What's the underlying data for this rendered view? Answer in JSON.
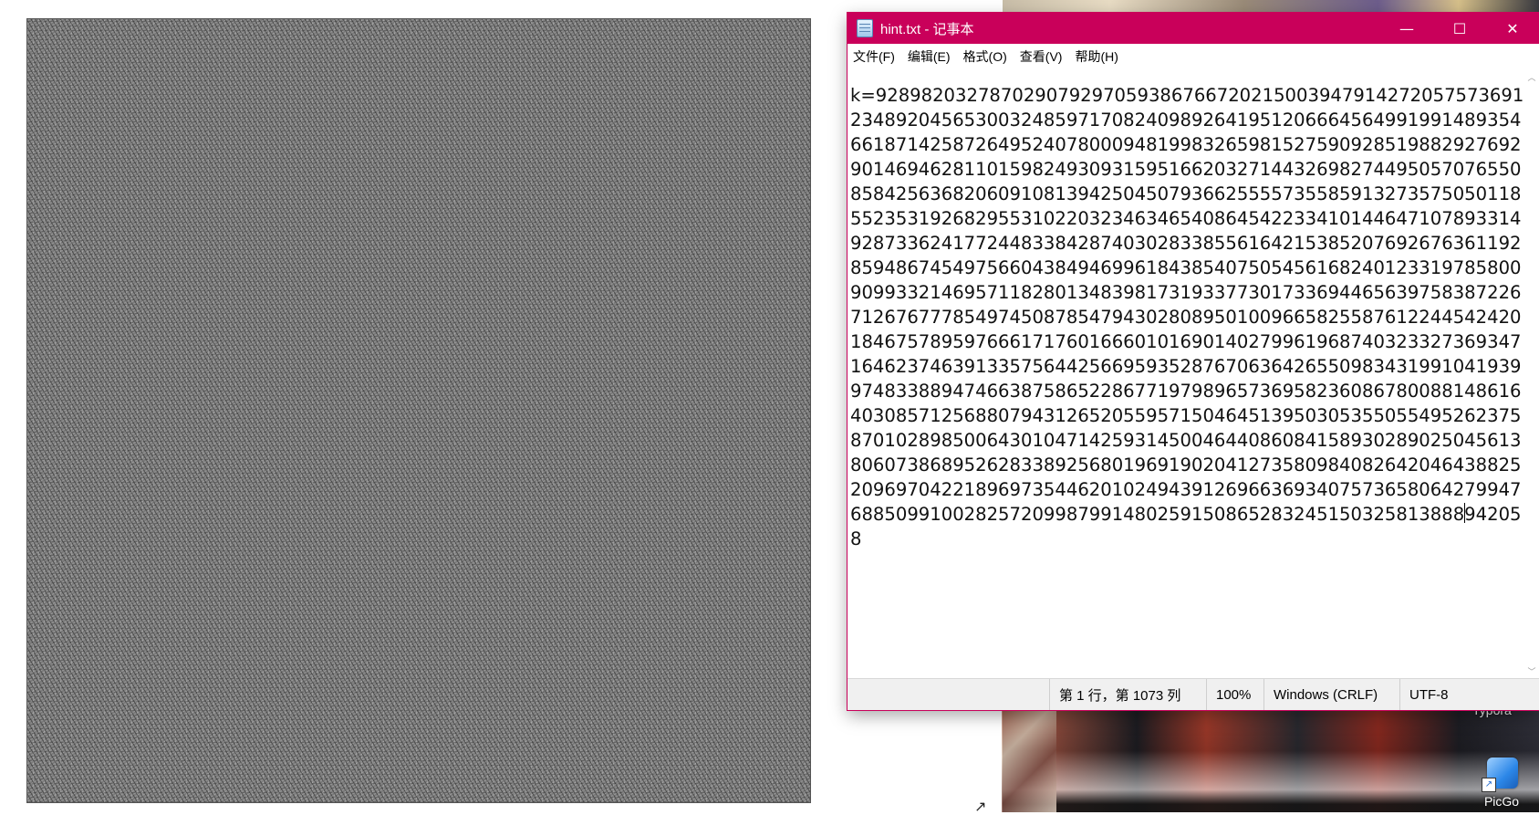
{
  "window": {
    "title": "hint.txt - 记事本",
    "controls": {
      "minimize": "—",
      "maximize": "☐",
      "close": "✕"
    }
  },
  "menu": [
    "文件(F)",
    "编辑(E)",
    "格式(O)",
    "查看(V)",
    "帮助(H)"
  ],
  "editor": {
    "text_before_caret": "k=92898203278702907929705938676672021500394791427205757369123489204565300324859717082409892641951206664564991991489354661871425872649524078000948199832659815275909285198829276929014694628110159824930931595166203271443269827449505707655085842563682060910813942504507936625555735585913273575050118552353192682955310220323463465408645422334101446471078933149287336241772448338428740302833855616421538520769267636119285948674549756604384946996184385407505456168240123319785800909933214695711828013483981731933773017336944656397583872267126767778549745087854794302808950100966582558761224454242018467578959766617176016660101690140279961968740323327369347164623746391335756442566959352876706364265509834319910419399748338894746638758652286771979896573695823608678008814861640308571256880794312652055957150464513950305355055495262375870102898500643010471425931450046440860841589302890250456138060738689526283389256801969190204127358098408264204643882520969704221896973544620102494391269663693407573658064279947688509910028257209987991480259150865283245150325813888",
    "text_after_caret": "942058"
  },
  "status": {
    "position": "第 1 行，第 1073 列",
    "zoom": "100%",
    "line_ending": "Windows (CRLF)",
    "encoding": "UTF-8"
  },
  "desktop": {
    "typora_label": "Typora",
    "picgo_label": "PicGo"
  },
  "colors": {
    "titlebar": "#c9005a",
    "statusbar": "#f0f0f0"
  },
  "icons": [
    "notepad-icon",
    "minimize-icon",
    "maximize-icon",
    "close-icon",
    "picgo-icon",
    "shortcut-arrow-icon"
  ]
}
